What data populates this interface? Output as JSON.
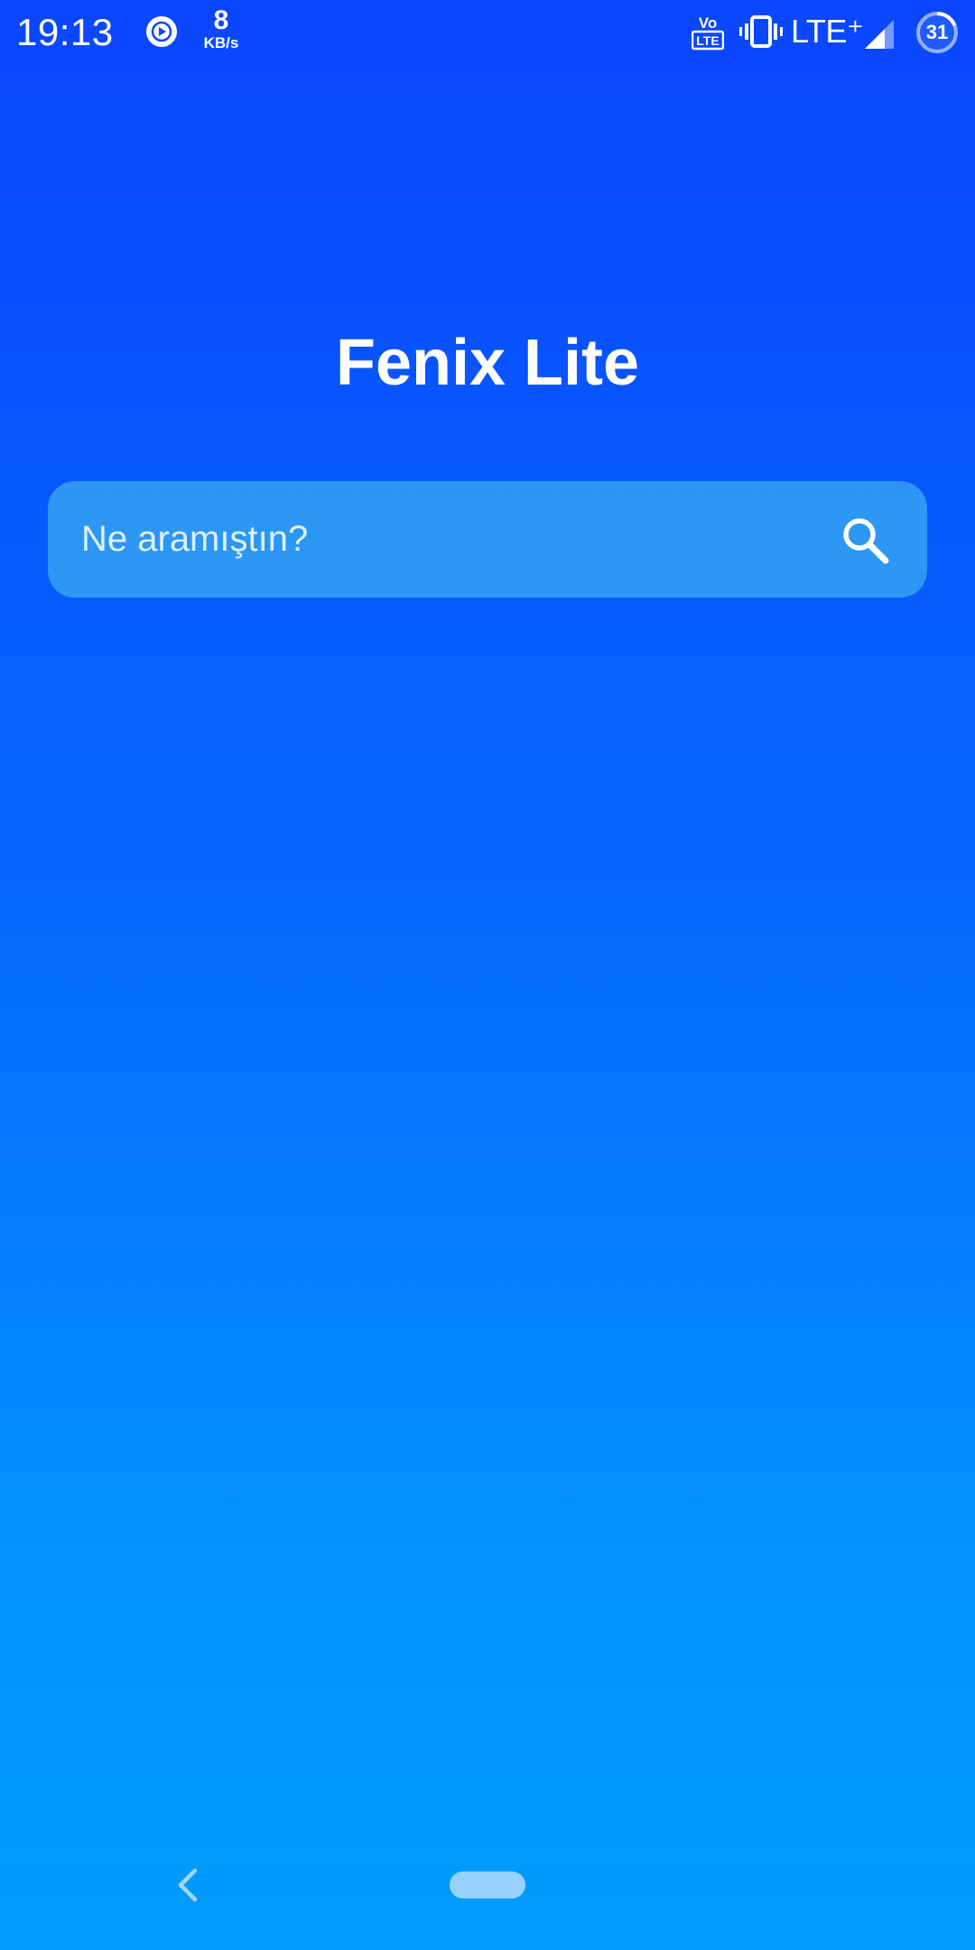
{
  "status_bar": {
    "time": "19:13",
    "net_speed_value": "8",
    "net_speed_unit": "KB/s",
    "volte_top": "Vo",
    "volte_bottom": "LTE",
    "network_type": "LTE⁺",
    "battery_level": "31",
    "icons": [
      "play-circle-icon",
      "volte-icon",
      "vibrate-icon",
      "signal-icon",
      "battery-icon"
    ]
  },
  "app": {
    "title": "Fenix Lite"
  },
  "search": {
    "placeholder": "Ne aramıştın?",
    "value": ""
  },
  "nav_bar": {
    "icons": [
      "back-chevron-icon",
      "home-pill"
    ]
  },
  "colors": {
    "background_top": "#0a46ff",
    "background_bottom": "#009cff",
    "search_field": "#3cafef",
    "text": "#ffffff"
  }
}
